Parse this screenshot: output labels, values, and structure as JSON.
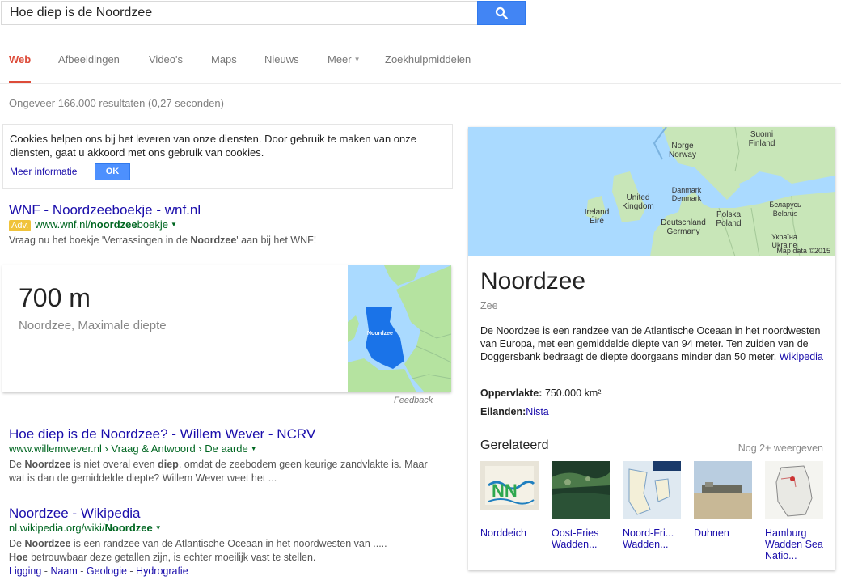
{
  "search": {
    "query": "Hoe diep is de Noordzee",
    "button_icon": "search-icon"
  },
  "tabs": [
    {
      "label": "Web",
      "active": true
    },
    {
      "label": "Afbeeldingen"
    },
    {
      "label": "Video's"
    },
    {
      "label": "Maps"
    },
    {
      "label": "Nieuws"
    },
    {
      "label": "Meer"
    },
    {
      "label": "Zoekhulpmiddelen"
    }
  ],
  "result_stats": "Ongeveer 166.000 resultaten (0,27 seconden)",
  "cookie": {
    "text": "Cookies helpen ons bij het leveren van onze diensten. Door gebruik te maken van onze diensten, gaat u akkoord met ons gebruik van cookies.",
    "more_label": "Meer informatie",
    "ok_label": "OK"
  },
  "ad": {
    "title": "WNF - Noordzeeboekje - wnf.nl",
    "badge": "Adv.",
    "url_pre": "www.wnf.nl/",
    "url_bold": "noordzee",
    "url_post": "boekje",
    "snippet_pre": "Vraag nu het boekje 'Verrassingen in de ",
    "snippet_bold": "Noordzee",
    "snippet_post": "' aan bij het WNF!"
  },
  "answer": {
    "value": "700 m",
    "subtitle": "Noordzee, Maximale diepte",
    "map_label": "Noordzee",
    "feedback": "Feedback"
  },
  "results": [
    {
      "title": "Hoe diep is de Noordzee? - Willem Wever - NCRV",
      "url": "www.willemwever.nl › Vraag & Antwoord › De aarde",
      "snippet_parts": [
        {
          "t": "De "
        },
        {
          "t": "Noordzee",
          "b": true
        },
        {
          "t": " is niet overal even "
        },
        {
          "t": "diep",
          "b": true
        },
        {
          "t": ", omdat de zeebodem geen keurige zandvlakte is. Maar wat is dan de gemiddelde diepte? Willem Wever weet het ..."
        }
      ]
    },
    {
      "title": "Noordzee - Wikipedia",
      "url_pre": "nl.wikipedia.org/wiki/",
      "url_bold": "Noordzee",
      "snippet_parts": [
        {
          "t": "De "
        },
        {
          "t": "Noordzee",
          "b": true
        },
        {
          "t": " is een randzee van de Atlantische Oceaan in het noordwesten van ..... "
        },
        {
          "t": "Hoe",
          "b": true
        },
        {
          "t": " betrouwbaar deze getallen zijn, is echter moeilijk vast te stellen."
        }
      ],
      "sitelinks": [
        "Ligging",
        "Naam",
        "Geologie",
        "Hydrografie"
      ]
    }
  ],
  "knowledge_panel": {
    "title": "Noordzee",
    "type": "Zee",
    "description": "De Noordzee is een randzee van de Atlantische Oceaan in het noordwesten van Europa, met een gemiddelde diepte van 94 meter. Ten zuiden van de Doggersbank bedraagt de diepte doorgaans minder dan 50 meter.",
    "source": "Wikipedia",
    "facts": [
      {
        "label": "Oppervlakte:",
        "value": "750.000 km²"
      },
      {
        "label": "Eilanden:",
        "value": "Nista",
        "link": true
      }
    ],
    "related_heading": "Gerelateerd",
    "related_more": "Nog 2+ weergeven",
    "related": [
      {
        "label": "Norddeich"
      },
      {
        "label": "Oost-Fries Wadden..."
      },
      {
        "label": "Noord-Fri... Wadden..."
      },
      {
        "label": "Duhnen"
      },
      {
        "label": "Hamburg Wadden Sea Natio..."
      }
    ],
    "map": {
      "labels": [
        "Suomi",
        "Finland",
        "Norge",
        "Norway",
        "United",
        "Kingdom",
        "Danmark",
        "Denmark",
        "Ireland",
        "Éire",
        "Deutschland",
        "Germany",
        "Polska",
        "Poland",
        "Беларусь",
        "Belarus",
        "Україна",
        "Ukraine"
      ],
      "attribution": "Map data ©2015"
    }
  },
  "colors": {
    "accent_red": "#dd4b39",
    "link_blue": "#1a0dab",
    "url_green": "#006621",
    "search_blue": "#4285f4"
  }
}
